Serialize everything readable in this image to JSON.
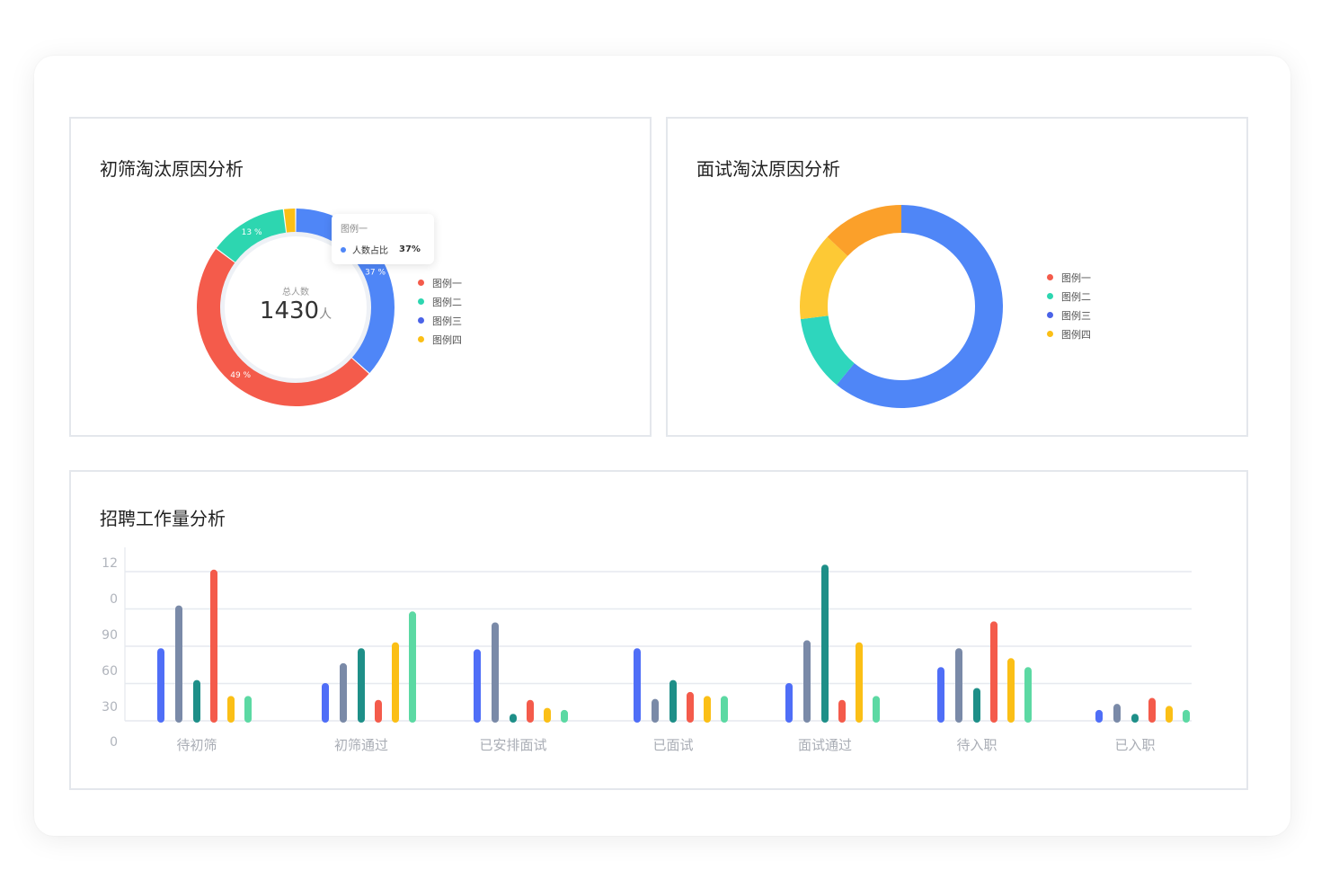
{
  "panels": {
    "screening": {
      "title": "初筛淘汰原因分析"
    },
    "interview": {
      "title": "面试淘汰原因分析"
    },
    "workload": {
      "title": "招聘工作量分析"
    }
  },
  "colors": {
    "blue": "#4f86f7",
    "red": "#f45b4b",
    "green": "#2dd6b0",
    "indigo": "#4a63e8",
    "yellow": "#fbbf16",
    "orange": "#fba02a",
    "gold": "#fdc935",
    "teal": "#2ed6bd",
    "slate": "#7a8aa8",
    "darkteal": "#1e8f88",
    "mint": "#5cd9a3"
  },
  "screening_center": {
    "sub": "总人数",
    "value": "1430",
    "unit": "人"
  },
  "tooltip": {
    "title": "图例一",
    "label": "人数占比",
    "value": "37%"
  },
  "legend1": [
    {
      "label": "图例一",
      "color": "#f45b4b"
    },
    {
      "label": "图例二",
      "color": "#2dd6b0"
    },
    {
      "label": "图例三",
      "color": "#4a63e8"
    },
    {
      "label": "图例四",
      "color": "#fbbf16"
    }
  ],
  "legend2": [
    {
      "label": "图例一",
      "color": "#f45b4b"
    },
    {
      "label": "图例二",
      "color": "#2dd6b0"
    },
    {
      "label": "图例三",
      "color": "#4a63e8"
    },
    {
      "label": "图例四",
      "color": "#fbbf16"
    }
  ],
  "chart_data": [
    {
      "type": "pie",
      "title": "初筛淘汰原因分析",
      "donut": true,
      "slices": [
        {
          "name": "图例一",
          "value": 37,
          "label": "37 %",
          "color": "#4f86f7"
        },
        {
          "name": "",
          "value": 49,
          "label": "49 %",
          "color": "#f45b4b"
        },
        {
          "name": "",
          "value": 13,
          "label": "13 %",
          "color": "#2dd6b0"
        },
        {
          "name": "",
          "value": 2,
          "label": "",
          "color": "#fbbf16"
        }
      ]
    },
    {
      "type": "pie",
      "title": "面试淘汰原因分析",
      "donut": true,
      "slices": [
        {
          "value": 61,
          "color": "#4f86f7"
        },
        {
          "value": 12,
          "color": "#2ed6bd"
        },
        {
          "value": 14,
          "color": "#fdc935"
        },
        {
          "value": 13,
          "color": "#fba02a"
        }
      ]
    },
    {
      "type": "bar",
      "title": "招聘工作量分析",
      "categories": [
        "待初筛",
        "初筛通过",
        "已安排面试",
        "已面试",
        "面试通过",
        "待入职",
        "已入职"
      ],
      "ytick_labels": [
        "0",
        "30",
        "60",
        "90",
        "0",
        "12"
      ],
      "ylim": [
        0,
        150
      ],
      "grid": true,
      "series": [
        {
          "color": "#4f6ef7",
          "values": [
            73,
            38,
            72,
            73,
            38,
            54,
            11
          ]
        },
        {
          "color": "#7a8aa8",
          "values": [
            116,
            58,
            99,
            22,
            81,
            73,
            17
          ]
        },
        {
          "color": "#1e8f88",
          "values": [
            41,
            73,
            7,
            41,
            157,
            33,
            7
          ]
        },
        {
          "color": "#f45b4b",
          "values": [
            152,
            21,
            21,
            29,
            21,
            100,
            23
          ]
        },
        {
          "color": "#fbbf16",
          "values": [
            25,
            79,
            13,
            25,
            79,
            63,
            15
          ]
        },
        {
          "color": "#5cd9a3",
          "values": [
            25,
            110,
            11,
            25,
            25,
            54,
            11
          ]
        }
      ]
    }
  ]
}
